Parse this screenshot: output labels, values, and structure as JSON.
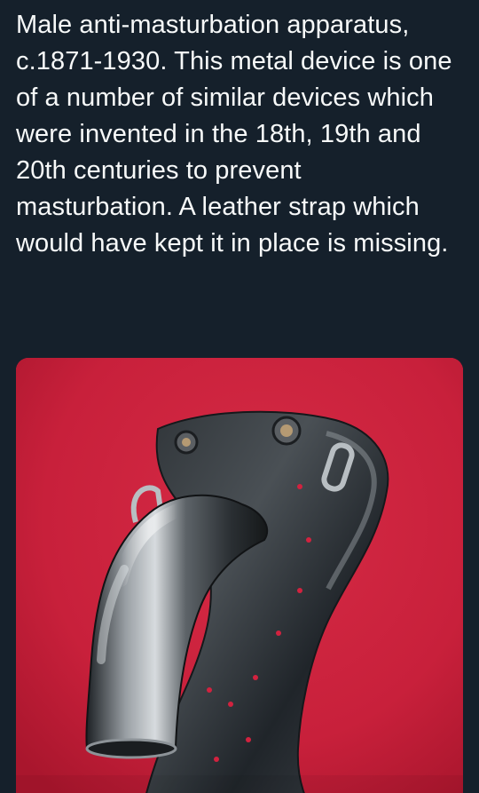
{
  "tweet": {
    "text": "Male anti-masturbation apparatus, c.1871-1930. This metal device is one of a number of similar devices which were invented in the 18th, 19th and 20th centuries to prevent masturbation. A leather strap which would have kept it in place is missing."
  },
  "media": {
    "background_color": "#c8203b",
    "metal_color": "#6f7478"
  }
}
